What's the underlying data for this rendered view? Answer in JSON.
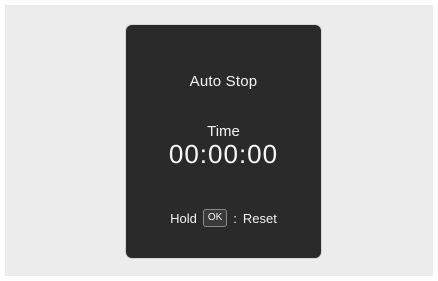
{
  "panel": {
    "title": "Auto Stop",
    "time_label": "Time",
    "time_value": "00:00:00",
    "hint": {
      "hold_label": "Hold",
      "key_label": "OK",
      "separator": ":",
      "action_label": "Reset"
    }
  },
  "colors": {
    "background": "#ececec",
    "panel": "#2a2a2a",
    "text": "#f2f2f2",
    "badge_border": "#8a8a8a"
  }
}
